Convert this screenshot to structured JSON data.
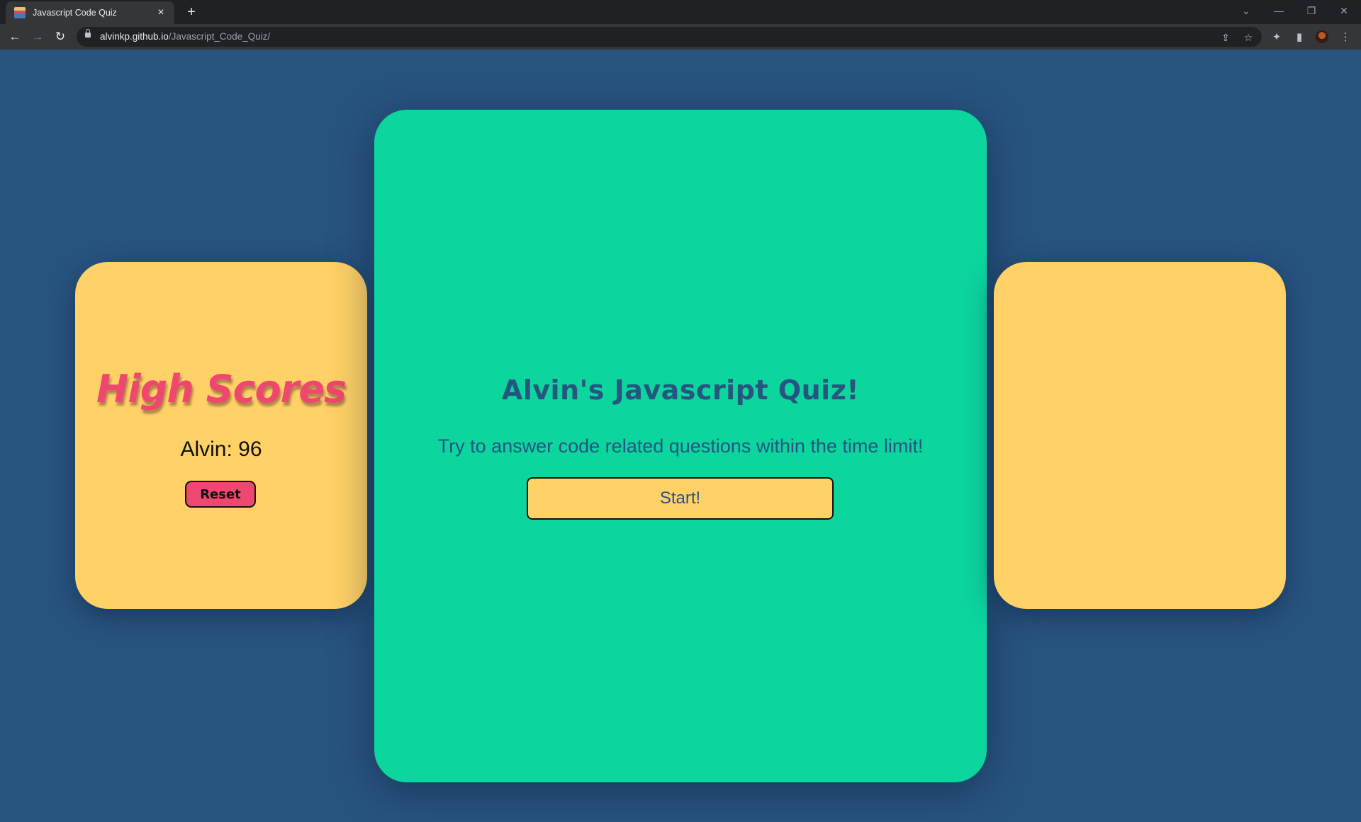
{
  "browser": {
    "tab_title": "Javascript Code Quiz",
    "tab_close_icon": "×",
    "new_tab_icon": "+",
    "url_host": "alvinkp.github.io",
    "url_path": "/Javascript_Code_Quiz/",
    "icons": {
      "back": "←",
      "forward": "→",
      "reload": "↻",
      "share": "⇪",
      "bookmark": "☆",
      "extensions": "✦",
      "side_panel": "▮",
      "menu": "⋮",
      "tab_search": "⌄",
      "minimize": "—",
      "restore": "❐",
      "close": "✕"
    }
  },
  "high_scores": {
    "title": "High Scores",
    "entries": [
      "Alvin: 96"
    ],
    "reset_label": "Reset"
  },
  "quiz": {
    "title": "Alvin's Javascript Quiz!",
    "subtitle": "Try to answer code related questions within the time limit!",
    "start_label": "Start!"
  },
  "colors": {
    "background": "#285480",
    "main_card": "#0cd59e",
    "side_cards": "#ffd166",
    "accent_pink": "#ef476f",
    "text_blue": "#26557f"
  }
}
